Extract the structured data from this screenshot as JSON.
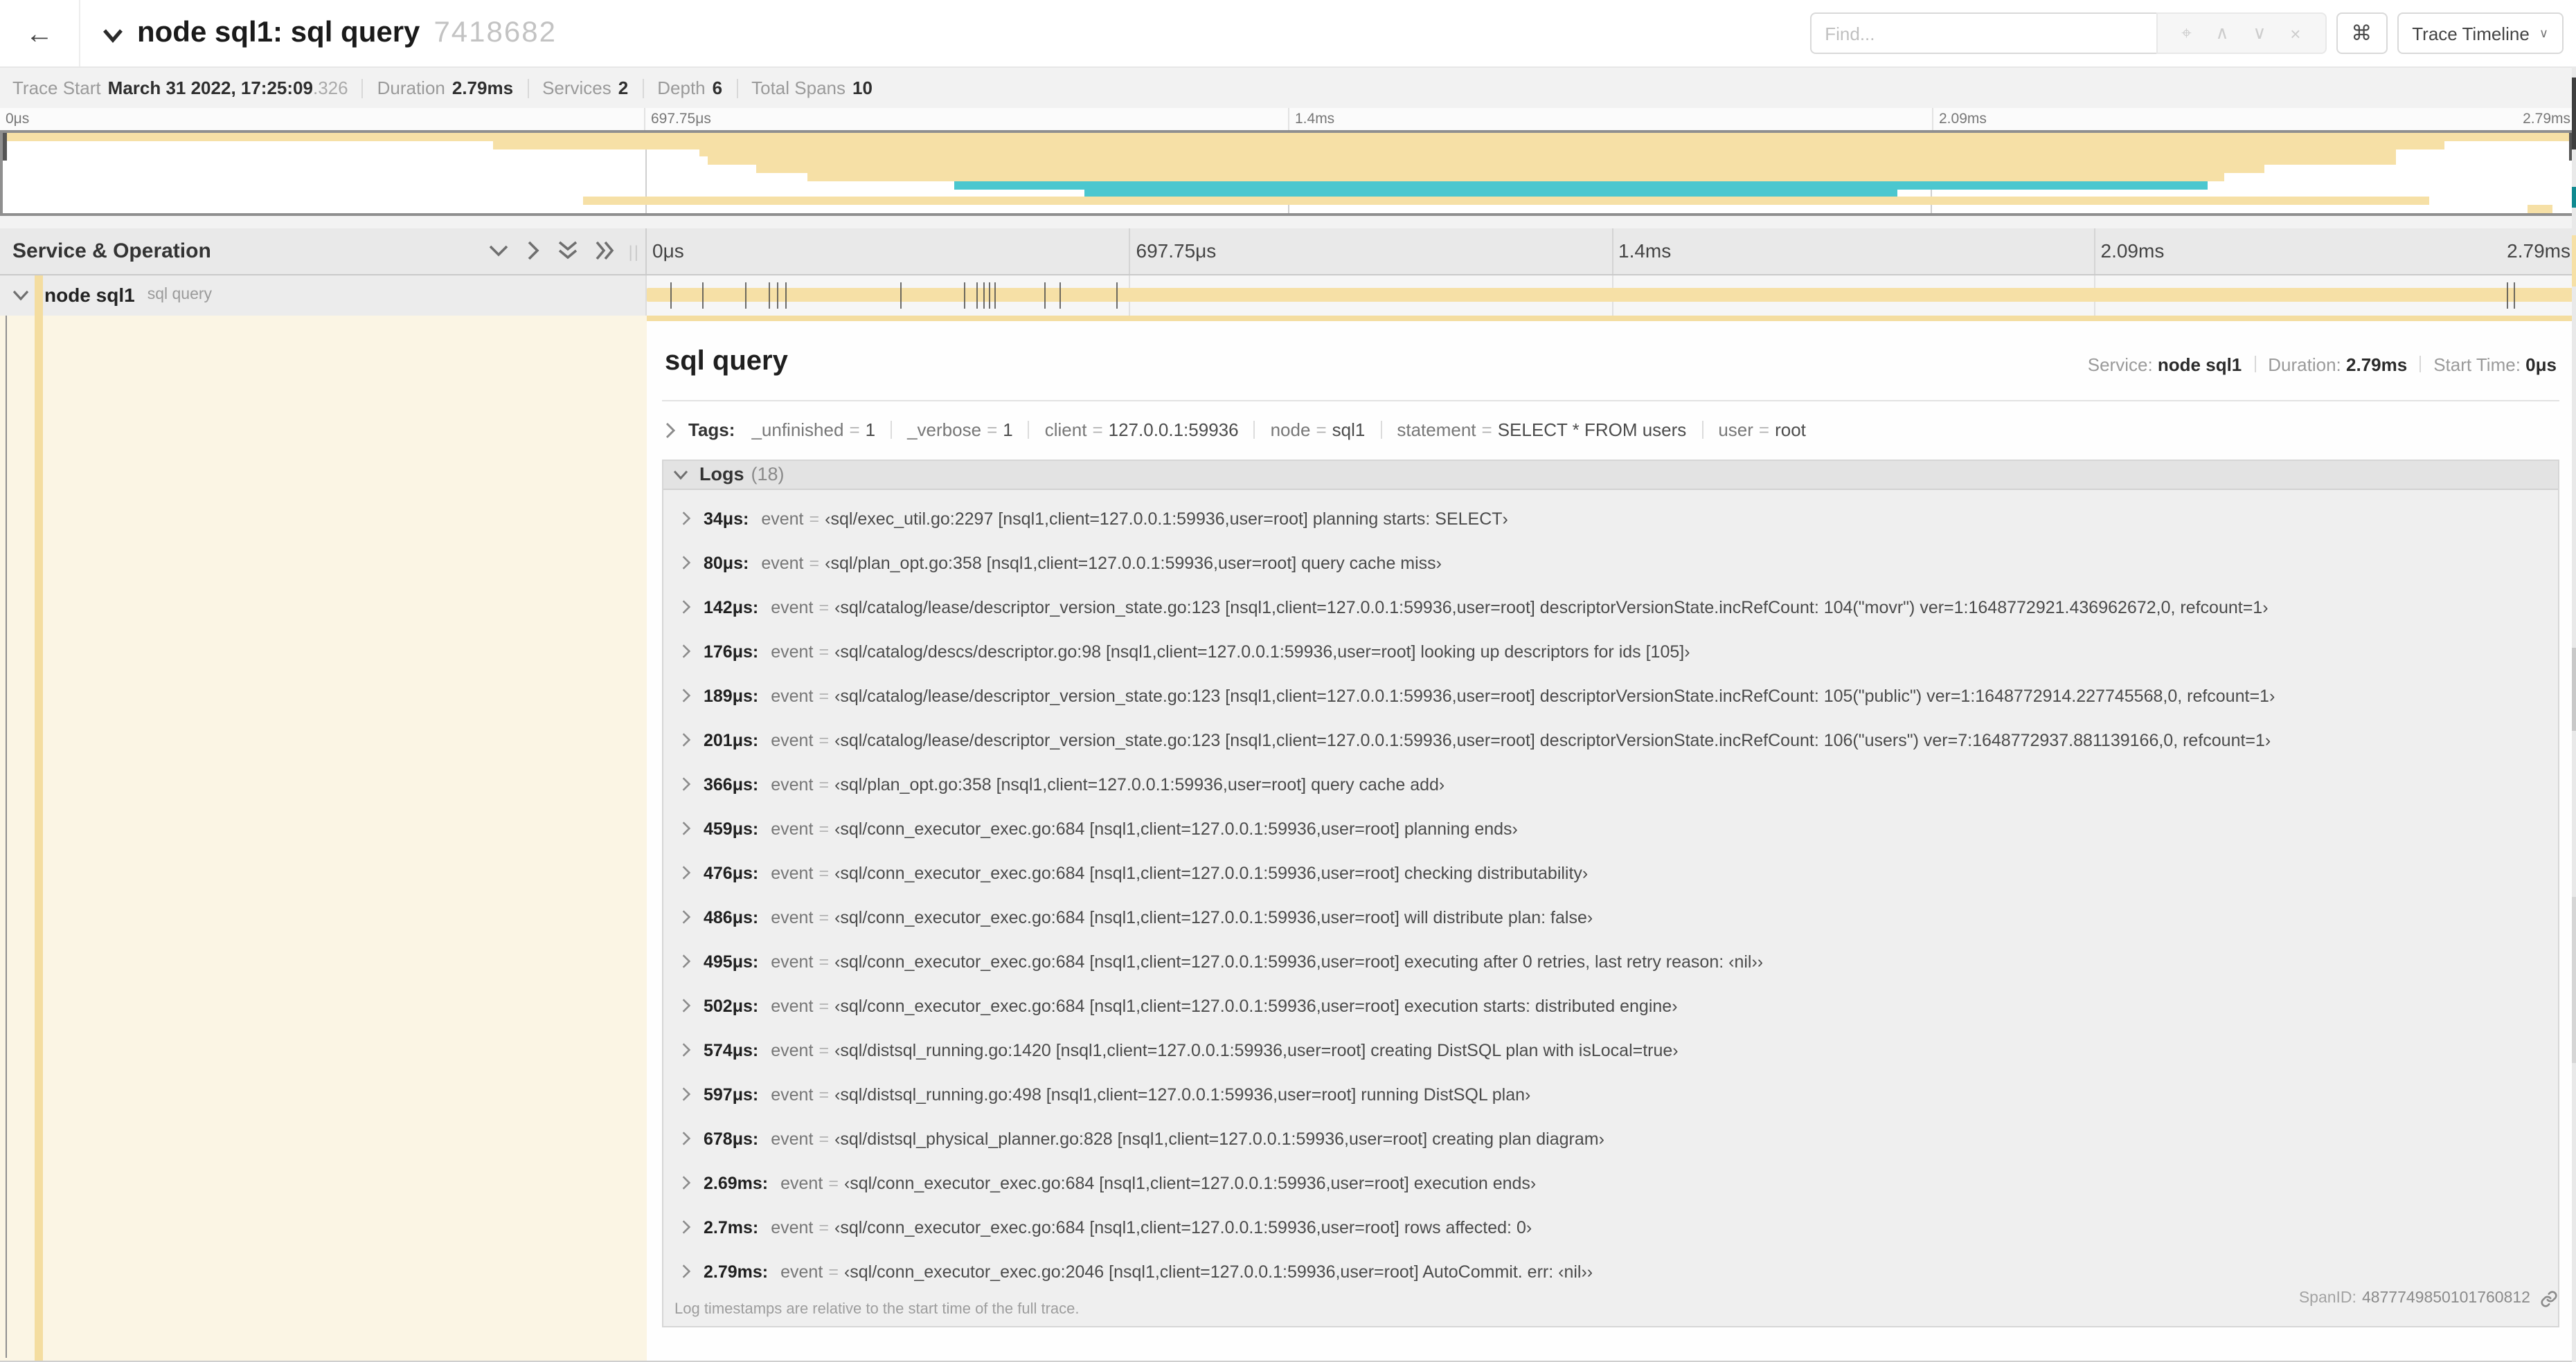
{
  "header": {
    "back_icon": "←",
    "title": "node sql1: sql query",
    "trace_id": "7418682",
    "find_placeholder": "Find...",
    "find_tools": [
      "target-icon",
      "caret-up-icon",
      "caret-down-icon",
      "clear-icon"
    ],
    "keyboard_shortcut": "⌘",
    "view_selector": "Trace Timeline"
  },
  "trace_meta": [
    {
      "label": "Trace Start",
      "value": "March 31 2022, 17:25:09",
      "suffix": ".326"
    },
    {
      "label": "Duration",
      "value": "2.79ms"
    },
    {
      "label": "Services",
      "value": "2"
    },
    {
      "label": "Depth",
      "value": "6"
    },
    {
      "label": "Total Spans",
      "value": "10"
    }
  ],
  "timeline": {
    "ticks": [
      "0μs",
      "697.75μs",
      "1.4ms",
      "2.09ms",
      "2.79ms"
    ],
    "duration_us": 2790,
    "column_header": "Service & Operation",
    "minimap_spans": [
      {
        "start": 0,
        "end": 100,
        "color": "tan"
      },
      {
        "start": 19.1,
        "end": 95.0,
        "color": "tan"
      },
      {
        "start": 27.1,
        "end": 93.1,
        "color": "tan"
      },
      {
        "start": 27.4,
        "end": 93.1,
        "color": "tan"
      },
      {
        "start": 29.3,
        "end": 88.0,
        "color": "tan"
      },
      {
        "start": 31.3,
        "end": 86.4,
        "color": "tan"
      },
      {
        "start": 37.0,
        "end": 85.8,
        "color": "teal"
      },
      {
        "start": 42.1,
        "end": 73.7,
        "color": "teal"
      },
      {
        "start": 22.6,
        "end": 94.4,
        "color": "tan"
      },
      {
        "start": 98.2,
        "end": 99.2,
        "color": "tan"
      }
    ],
    "span_row": {
      "service": "node sql1",
      "operation": "sql query",
      "bar": {
        "start": 0,
        "end": 100,
        "color": "tan"
      },
      "log_marker_us": [
        34,
        80,
        142,
        176,
        189,
        201,
        366,
        459,
        476,
        486,
        495,
        502,
        574,
        597,
        678,
        2690,
        2700,
        2790
      ]
    }
  },
  "detail": {
    "operation": "sql query",
    "meta": [
      {
        "label": "Service:",
        "value": "node sql1"
      },
      {
        "label": "Duration:",
        "value": "2.79ms"
      },
      {
        "label": "Start Time:",
        "value": "0μs"
      }
    ],
    "tags": {
      "label": "Tags:",
      "items": [
        {
          "key": "_unfinished",
          "value": "1"
        },
        {
          "key": "_verbose",
          "value": "1"
        },
        {
          "key": "client",
          "value": "127.0.0.1:59936"
        },
        {
          "key": "node",
          "value": "sql1"
        },
        {
          "key": "statement",
          "value": "SELECT * FROM users"
        },
        {
          "key": "user",
          "value": "root"
        }
      ]
    },
    "logs": {
      "label": "Logs",
      "count": "(18)",
      "rows": [
        {
          "ts": "34μs:",
          "key": "event",
          "value": "‹sql/exec_util.go:2297 [nsql1,client=127.0.0.1:59936,user=root] planning starts: SELECT›"
        },
        {
          "ts": "80μs:",
          "key": "event",
          "value": "‹sql/plan_opt.go:358 [nsql1,client=127.0.0.1:59936,user=root] query cache miss›"
        },
        {
          "ts": "142μs:",
          "key": "event",
          "value": "‹sql/catalog/lease/descriptor_version_state.go:123 [nsql1,client=127.0.0.1:59936,user=root] descriptorVersionState.incRefCount: 104(\"movr\") ver=1:1648772921.436962672,0, refcount=1›"
        },
        {
          "ts": "176μs:",
          "key": "event",
          "value": "‹sql/catalog/descs/descriptor.go:98 [nsql1,client=127.0.0.1:59936,user=root] looking up descriptors for ids [105]›"
        },
        {
          "ts": "189μs:",
          "key": "event",
          "value": "‹sql/catalog/lease/descriptor_version_state.go:123 [nsql1,client=127.0.0.1:59936,user=root] descriptorVersionState.incRefCount: 105(\"public\") ver=1:1648772914.227745568,0, refcount=1›"
        },
        {
          "ts": "201μs:",
          "key": "event",
          "value": "‹sql/catalog/lease/descriptor_version_state.go:123 [nsql1,client=127.0.0.1:59936,user=root] descriptorVersionState.incRefCount: 106(\"users\") ver=7:1648772937.881139166,0, refcount=1›"
        },
        {
          "ts": "366μs:",
          "key": "event",
          "value": "‹sql/plan_opt.go:358 [nsql1,client=127.0.0.1:59936,user=root] query cache add›"
        },
        {
          "ts": "459μs:",
          "key": "event",
          "value": "‹sql/conn_executor_exec.go:684 [nsql1,client=127.0.0.1:59936,user=root] planning ends›"
        },
        {
          "ts": "476μs:",
          "key": "event",
          "value": "‹sql/conn_executor_exec.go:684 [nsql1,client=127.0.0.1:59936,user=root] checking distributability›"
        },
        {
          "ts": "486μs:",
          "key": "event",
          "value": "‹sql/conn_executor_exec.go:684 [nsql1,client=127.0.0.1:59936,user=root] will distribute plan: false›"
        },
        {
          "ts": "495μs:",
          "key": "event",
          "value": "‹sql/conn_executor_exec.go:684 [nsql1,client=127.0.0.1:59936,user=root] executing after 0 retries, last retry reason: ‹nil››"
        },
        {
          "ts": "502μs:",
          "key": "event",
          "value": "‹sql/conn_executor_exec.go:684 [nsql1,client=127.0.0.1:59936,user=root] execution starts: distributed engine›"
        },
        {
          "ts": "574μs:",
          "key": "event",
          "value": "‹sql/distsql_running.go:1420 [nsql1,client=127.0.0.1:59936,user=root] creating DistSQL plan with isLocal=true›"
        },
        {
          "ts": "597μs:",
          "key": "event",
          "value": "‹sql/distsql_running.go:498 [nsql1,client=127.0.0.1:59936,user=root] running DistSQL plan›"
        },
        {
          "ts": "678μs:",
          "key": "event",
          "value": "‹sql/distsql_physical_planner.go:828 [nsql1,client=127.0.0.1:59936,user=root] creating plan diagram›"
        },
        {
          "ts": "2.69ms:",
          "key": "event",
          "value": "‹sql/conn_executor_exec.go:684 [nsql1,client=127.0.0.1:59936,user=root] execution ends›"
        },
        {
          "ts": "2.7ms:",
          "key": "event",
          "value": "‹sql/conn_executor_exec.go:684 [nsql1,client=127.0.0.1:59936,user=root] rows affected: 0›"
        },
        {
          "ts": "2.79ms:",
          "key": "event",
          "value": "‹sql/conn_executor_exec.go:2046 [nsql1,client=127.0.0.1:59936,user=root] AutoCommit. err: ‹nil››"
        }
      ],
      "note": "Log timestamps are relative to the start time of the full trace."
    },
    "footer": {
      "label": "SpanID:",
      "value": "4877749850101760812"
    }
  },
  "colors": {
    "tan": "#F6E0A6",
    "tan_accent": "#F4DDA0",
    "teal": "#4BC7CF",
    "cream": "#FBF5E4"
  }
}
